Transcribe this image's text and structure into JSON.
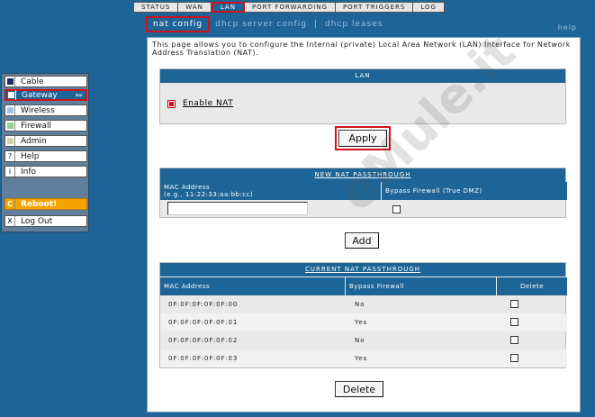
{
  "tabs": [
    "STATUS",
    "WAN",
    "LAN",
    "PORT FORWARDING",
    "PORT TRIGGERS",
    "LOG"
  ],
  "subnav": {
    "nat_config": "nat config",
    "dhcp_server_config": "dhcp server config",
    "dhcp_leases": "dhcp leases",
    "help": "help",
    "sep": "|"
  },
  "sidebar": {
    "cable": "Cable",
    "gateway": "Gateway",
    "gateway_arrow": "»»",
    "wireless": "Wireless",
    "firewall": "Firewall",
    "admin": "Admin",
    "help": "Help",
    "info": "Info",
    "reboot": "Reboot!",
    "logout": "Log Out",
    "help_icon": "?",
    "info_icon": "i",
    "reboot_icon": "C",
    "logout_icon": "X"
  },
  "intro": "This page allows you to configure the Internal (private) Local Area Network (LAN) Interface for Network Address Translation (NAT).",
  "lan": {
    "title": "LAN",
    "enable_nat_label": "Enable NAT",
    "enable_nat_checked": true,
    "apply": "Apply"
  },
  "new_passthrough": {
    "title": "NEW NAT PASSTHROUGH",
    "mac_header": "MAC Address\n(e.g., 11:22:33:aa:bb:cc)",
    "mac_header_line1": "MAC Address",
    "mac_header_line2": "(e.g., 11:22:33:aa:bb:cc)",
    "bypass_header": "Bypass Firewall (True DMZ)",
    "mac_value": "",
    "add": "Add"
  },
  "current_passthrough": {
    "title": "CURRENT NAT PASSTHROUGH",
    "headers": [
      "MAC Address",
      "Bypass Firewall",
      "Delete"
    ],
    "rows": [
      {
        "mac": "0F:0F:0F:0F:0F:00",
        "bypass": "No"
      },
      {
        "mac": "0F:0F:0F:0F:0F:01",
        "bypass": "Yes"
      },
      {
        "mac": "0F:0F:0F:0F:0F:02",
        "bypass": "No"
      },
      {
        "mac": "0F:0F:0F:0F:0F:03",
        "bypass": "Yes"
      }
    ],
    "delete": "Delete"
  },
  "watermark": "eMule.it",
  "colors": {
    "brand_blue": "#1d6497",
    "highlight_red": "#d0121b",
    "reboot_orange": "#f5a300"
  }
}
